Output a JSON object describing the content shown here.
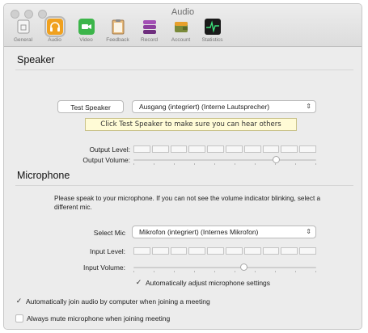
{
  "window": {
    "title": "Audio"
  },
  "toolbar": {
    "items": [
      {
        "label": "General",
        "icon": "general-icon",
        "color": "#9a9a9a"
      },
      {
        "label": "Audio",
        "icon": "headphones-icon",
        "color": "#f0a11f"
      },
      {
        "label": "Video",
        "icon": "video-camera-icon",
        "color": "#3cb54a"
      },
      {
        "label": "Feedback",
        "icon": "clipboard-icon",
        "color": "#e6b878"
      },
      {
        "label": "Record",
        "icon": "record-stack-icon",
        "color": "#8d3f9e"
      },
      {
        "label": "Account",
        "icon": "wallet-icon",
        "color": "#7a8a3a"
      },
      {
        "label": "Statistics",
        "icon": "pulse-icon",
        "color": "#1a1a1a"
      }
    ],
    "active": "Audio"
  },
  "speaker": {
    "heading": "Speaker",
    "test_button": "Test Speaker",
    "output_device": "Ausgang (integriert) (Interne Lautsprecher)",
    "tip": "Click Test Speaker to make sure you can hear others",
    "output_level_label": "Output Level:",
    "output_volume_label": "Output Volume:",
    "output_volume": 0.78
  },
  "microphone": {
    "heading": "Microphone",
    "info": "Please speak to your microphone. If you can not see the volume indicator blinking, select a different mic.",
    "select_label": "Select Mic",
    "input_device": "Mikrofon (integriert) (Internes Mikrofon)",
    "input_level_label": "Input Level:",
    "input_volume_label": "Input Volume:",
    "input_volume": 0.6,
    "auto_adjust_label": "Automatically adjust microphone settings",
    "auto_adjust_checked": true
  },
  "options": {
    "auto_join_label": "Automatically join audio by computer when joining a meeting",
    "auto_join_checked": true,
    "mute_label": "Always mute microphone when joining meeting",
    "mute_checked": false
  }
}
